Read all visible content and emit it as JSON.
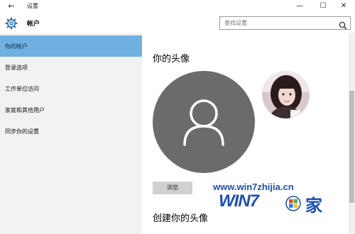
{
  "titlebar": {
    "back_icon": "back-arrow-icon",
    "title": "设置",
    "minimize_icon": "minimize-icon",
    "maximize_icon": "maximize-icon",
    "close_icon": "close-icon"
  },
  "header": {
    "icon": "gear-icon",
    "title": "帐户",
    "search": {
      "placeholder": "查找设置",
      "icon": "search-icon"
    }
  },
  "sidebar": {
    "items": [
      {
        "label": "你的帐户",
        "active": true
      },
      {
        "label": "登录选项",
        "active": false
      },
      {
        "label": "工作单位访问",
        "active": false
      },
      {
        "label": "家庭和其他用户",
        "active": false
      },
      {
        "label": "同步你的设置",
        "active": false
      }
    ]
  },
  "main": {
    "section_title": "你的头像",
    "default_avatar_icon": "user-avatar-icon",
    "photo": "profile-photo",
    "browse_label": "浏览",
    "create_title": "创建你的头像"
  },
  "watermark": {
    "url": "www.win7zhijia.cn",
    "logo": "WIN7",
    "suffix": "家"
  },
  "colors": {
    "active_nav": "#6fb0e0",
    "sidebar_bg": "#f2f2f2",
    "avatar_bg": "#6b6b6b",
    "watermark_blue": "#1d4fb0"
  }
}
